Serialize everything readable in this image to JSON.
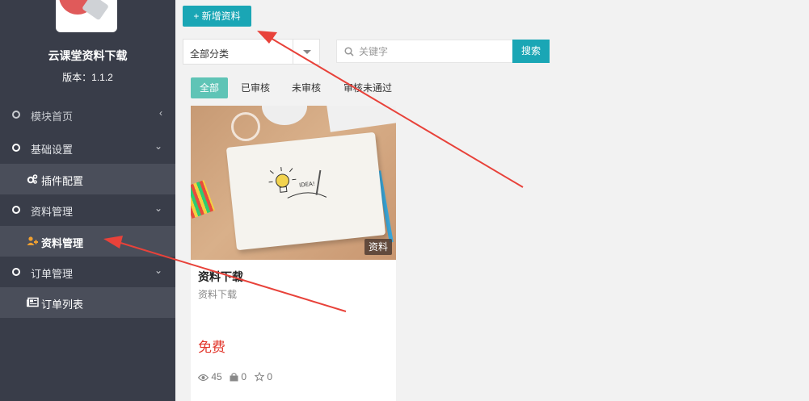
{
  "sidebar": {
    "app_name": "云课堂资料下载",
    "version": "版本：1.1.2",
    "items": [
      {
        "label": "模块首页",
        "chevron": "‹"
      },
      {
        "label": "基础设置",
        "chevron": "⌄"
      },
      {
        "label": "插件配置"
      },
      {
        "label": "资料管理",
        "chevron": "⌄"
      },
      {
        "label": "资料管理"
      },
      {
        "label": "订单管理",
        "chevron": "⌄"
      },
      {
        "label": "订单列表"
      }
    ]
  },
  "toolbar": {
    "add_label": "+ 新增资料",
    "category_value": "全部分类",
    "search_placeholder": "关键字",
    "search_label": "搜索"
  },
  "tabs": [
    "全部",
    "已审核",
    "未审核",
    "审核未通过"
  ],
  "card": {
    "badge": "资料",
    "title": "资料下载",
    "subtitle": "资料下载",
    "price": "免费",
    "views": "45",
    "downloads": "0",
    "favorites": "0"
  },
  "colors": {
    "sidebar_bg": "#393d49",
    "submenu_bg": "#4a4e5a",
    "accent": "#1aa6b5",
    "tab_active": "#5fc4b6",
    "price": "#e2362b",
    "annotation_arrow": "#e8423a",
    "submenu_active_icon": "#f0a030"
  }
}
